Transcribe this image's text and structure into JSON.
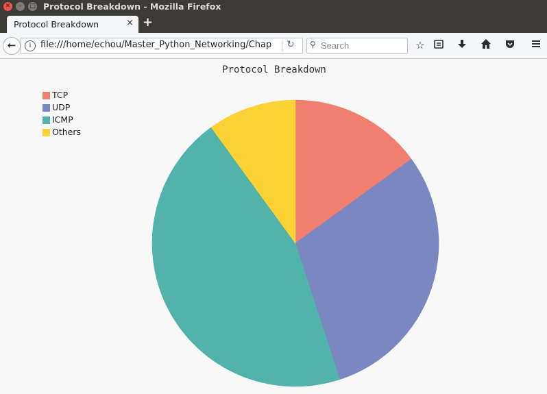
{
  "window": {
    "title": "Protocol Breakdown - Mozilla Firefox"
  },
  "tabs": [
    {
      "label": "Protocol Breakdown",
      "close": "×"
    }
  ],
  "new_tab": "+",
  "navbar": {
    "back": "←",
    "info": "i",
    "url": "file:///home/echou/Master_Python_Networking/Chap",
    "reload": "↻",
    "search_placeholder": "Search",
    "search_icon": "magnifier-icon",
    "icons": [
      "star-icon",
      "reading-list-icon",
      "download-icon",
      "home-icon",
      "pocket-icon",
      "menu-icon"
    ]
  },
  "chart_data": {
    "type": "pie",
    "title": "Protocol Breakdown",
    "legend_position": "top-left",
    "categories": [
      "TCP",
      "UDP",
      "ICMP",
      "Others"
    ],
    "values": [
      15,
      30,
      45,
      10
    ],
    "colors": [
      "#f07f6f",
      "#7b87c0",
      "#52b3aa",
      "#fdd235"
    ]
  }
}
